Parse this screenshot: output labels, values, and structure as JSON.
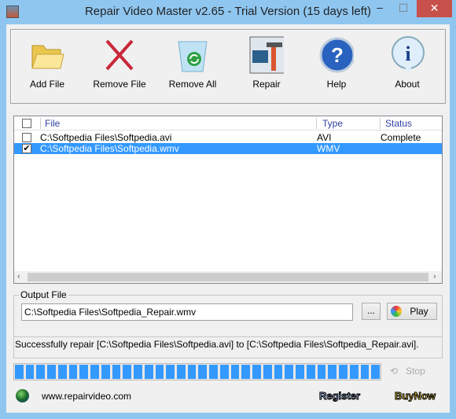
{
  "window": {
    "title": "Repair Video Master v2.65 - Trial Version (15 days left)"
  },
  "toolbar": {
    "items": [
      {
        "label": "Add File",
        "icon": "folder-icon"
      },
      {
        "label": "Remove File",
        "icon": "red-x-icon"
      },
      {
        "label": "Remove All",
        "icon": "recycle-bin-icon"
      },
      {
        "label": "Repair",
        "icon": "repair-tools-icon"
      },
      {
        "label": "Help",
        "icon": "question-icon"
      },
      {
        "label": "About",
        "icon": "info-icon"
      }
    ]
  },
  "file_list": {
    "columns": [
      "File",
      "Type",
      "Status"
    ],
    "rows": [
      {
        "file": "C:\\Softpedia Files\\Softpedia.avi",
        "type": "AVI",
        "status": "Complete",
        "checked": false,
        "selected": false
      },
      {
        "file": "C:\\Softpedia Files\\Softpedia.wmv",
        "type": "WMV",
        "status": "",
        "checked": true,
        "selected": true
      }
    ]
  },
  "output": {
    "label": "Output File",
    "value": "C:\\Softpedia Files\\Softpedia_Repair.wmv",
    "browse_label": "...",
    "play_label": "Play"
  },
  "status_text": "Successfully repair [C:\\Softpedia Files\\Softpedia.avi] to [C:\\Softpedia Files\\Softpedia_Repair.avi].",
  "progress_percent": 100,
  "stop_label": "Stop",
  "footer": {
    "url": "www.repairvideo.com",
    "register_label": "Register",
    "buynow_label": "BuyNow"
  },
  "colors": {
    "selection": "#3399ff",
    "progress": "#3399ff",
    "frame": "#8fc6f0",
    "close": "#c7504a"
  }
}
